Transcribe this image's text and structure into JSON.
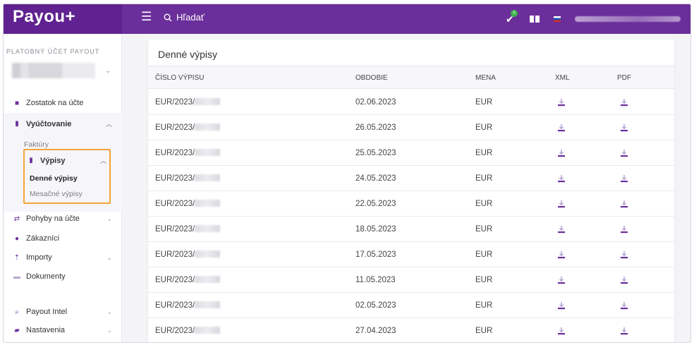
{
  "header": {
    "logo": "Payou+",
    "menu_icon": "menu-icon",
    "search_label": "Hľadať",
    "notifications_count": "0"
  },
  "sidebar": {
    "account_label": "PLATOBNÝ ÚČET PAYOUT",
    "items": [
      {
        "label": "Zostatok na účte",
        "icon": "wallet-icon"
      },
      {
        "label": "Vyúčtovanie",
        "icon": "document-icon"
      },
      {
        "label": "Faktúry"
      },
      {
        "label": "Výpisy",
        "icon": "document-icon"
      },
      {
        "label": "Denné výpisy"
      },
      {
        "label": "Mesačné výpisy"
      },
      {
        "label": "Pohyby na účte",
        "icon": "transfer-icon"
      },
      {
        "label": "Zákazníci",
        "icon": "user-icon"
      },
      {
        "label": "Importy",
        "icon": "upload-icon"
      },
      {
        "label": "Dokumenty",
        "icon": "folder-icon"
      },
      {
        "label": "Payout Intel",
        "icon": "search-icon"
      },
      {
        "label": "Nastavenia",
        "icon": "briefcase-icon"
      }
    ]
  },
  "main": {
    "title": "Denné výpisy",
    "columns": [
      "ČÍSLO VÝPISU",
      "OBDOBIE",
      "MENA",
      "XML",
      "PDF"
    ],
    "rows": [
      {
        "number": "EUR/2023/",
        "date": "02.06.2023",
        "currency": "EUR"
      },
      {
        "number": "EUR/2023/",
        "date": "26.05.2023",
        "currency": "EUR"
      },
      {
        "number": "EUR/2023/",
        "date": "25.05.2023",
        "currency": "EUR"
      },
      {
        "number": "EUR/2023/",
        "date": "24.05.2023",
        "currency": "EUR"
      },
      {
        "number": "EUR/2023/",
        "date": "22.05.2023",
        "currency": "EUR"
      },
      {
        "number": "EUR/2023/",
        "date": "18.05.2023",
        "currency": "EUR"
      },
      {
        "number": "EUR/2023/",
        "date": "17.05.2023",
        "currency": "EUR"
      },
      {
        "number": "EUR/2023/",
        "date": "11.05.2023",
        "currency": "EUR"
      },
      {
        "number": "EUR/2023/",
        "date": "02.05.2023",
        "currency": "EUR"
      },
      {
        "number": "EUR/2023/",
        "date": "27.04.2023",
        "currency": "EUR"
      }
    ]
  },
  "colors": {
    "brand": "#6b2f9b",
    "highlight": "#f3a43a"
  }
}
